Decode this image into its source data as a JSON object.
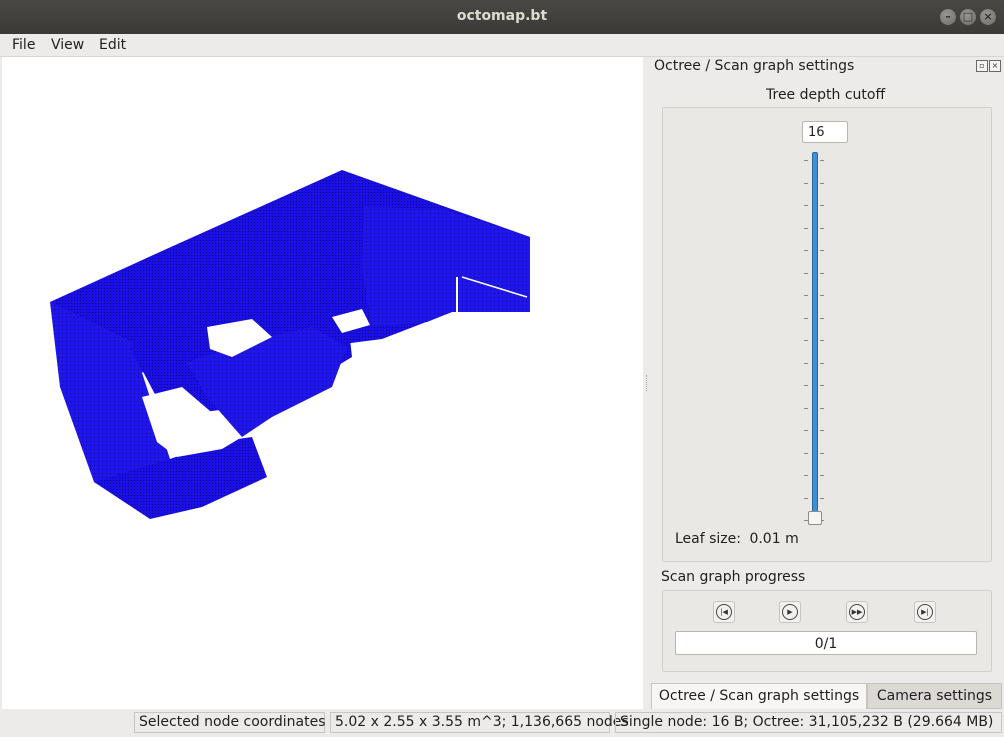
{
  "window": {
    "title": "octomap.bt"
  },
  "menu": {
    "items": [
      "File",
      "View",
      "Edit"
    ]
  },
  "dock": {
    "title": "Octree / Scan graph settings",
    "tree_depth": {
      "label": "Tree depth cutoff",
      "value": "16",
      "leaf_size_label": "Leaf size:",
      "leaf_size_value": "0.01 m"
    },
    "scan_graph": {
      "label": "Scan graph progress",
      "progress_text": "0/1",
      "buttons": [
        "skip-to-start-icon",
        "play-icon",
        "fast-forward-icon",
        "skip-to-end-icon"
      ]
    },
    "tabs": [
      "Octree / Scan graph settings",
      "Camera settings"
    ]
  },
  "status": {
    "selected": "Selected node coordinates",
    "size": "5.02 x 2.55 x 3.55 m^3; 1,136,665 nodes",
    "memory": "Single node: 16 B; Octree: 31,105,232 B (29.664 MB)"
  },
  "colors": {
    "voxel": "#1a0fe6",
    "voxel_dark": "#0e0a8a",
    "slider": "#3d8fd6"
  }
}
